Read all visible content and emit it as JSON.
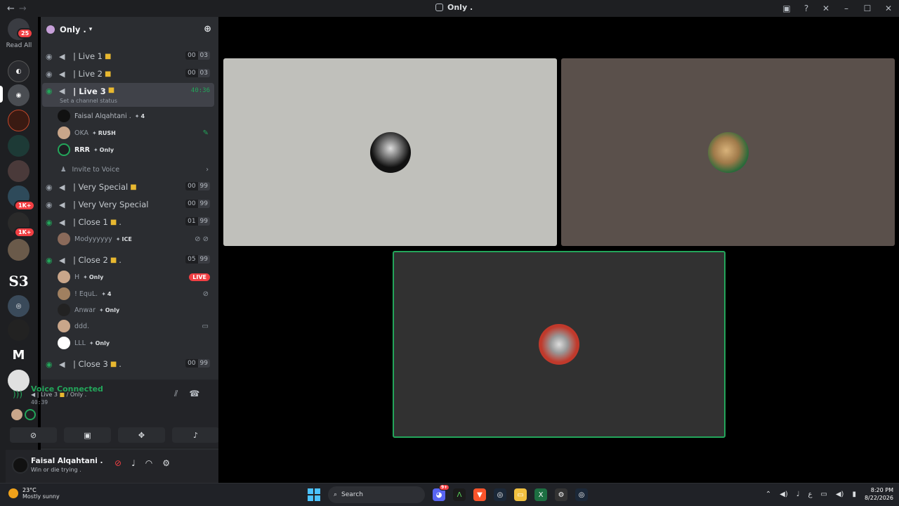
{
  "window": {
    "title": "Only ."
  },
  "servers": {
    "unread_badge": "25",
    "read_all": "Read All",
    "badges": [
      "1K+",
      "1K+"
    ],
    "s3_label": "S3"
  },
  "guild": {
    "name": "Only ."
  },
  "channels": [
    {
      "name": "| Live 1",
      "lock": true,
      "counts": [
        "00",
        "03"
      ]
    },
    {
      "name": "| Live 2",
      "lock": true,
      "counts": [
        "00",
        "03"
      ]
    },
    {
      "name": "| Live 3",
      "lock": true,
      "timer": "40:36",
      "status": "Set a channel status"
    },
    {
      "name": "| Very Special",
      "lock": true,
      "counts": [
        "00",
        "99"
      ]
    },
    {
      "name": "| Very Very Special",
      "lock": false,
      "counts": [
        "00",
        "99"
      ]
    },
    {
      "name": "| Close 1",
      "lock": true,
      "suffix": ".",
      "counts": [
        "01",
        "99"
      ]
    },
    {
      "name": "| Close 2",
      "lock": true,
      "suffix": ".",
      "counts": [
        "05",
        "99"
      ]
    },
    {
      "name": "| Close 3",
      "lock": true,
      "suffix": ".",
      "counts": [
        "00",
        "99"
      ]
    }
  ],
  "live3_users": [
    {
      "name": "Faisal Alqahtani .",
      "tag": "4"
    },
    {
      "name": "OKA",
      "tag": "RUSH"
    },
    {
      "name": "RRR",
      "tag": "Only"
    }
  ],
  "invite_label": "Invite to Voice",
  "close1_users": [
    {
      "name": "Modyyyyyy",
      "tag": "ICE"
    }
  ],
  "close2_users": [
    {
      "name": "H",
      "tag": "Only",
      "live": "LIVE"
    },
    {
      "name": "! EquL.",
      "tag": "4"
    },
    {
      "name": "Anwar",
      "tag": "Only"
    },
    {
      "name": "ddd.",
      "tag": ""
    },
    {
      "name": "LLL",
      "tag": "Only"
    }
  ],
  "voice": {
    "title": "Voice Connected",
    "channel": "| Live 3",
    "guild": "/ Only .",
    "time": "40:39"
  },
  "user": {
    "name": "Faisal Alqahtani .",
    "status": "Win or die trying ."
  },
  "taskbar": {
    "temp": "23°C",
    "weather": "Mostly sunny",
    "search": "Search",
    "time": "8:20 PM",
    "date": "8/22/2026",
    "discord_badge": "9+"
  }
}
